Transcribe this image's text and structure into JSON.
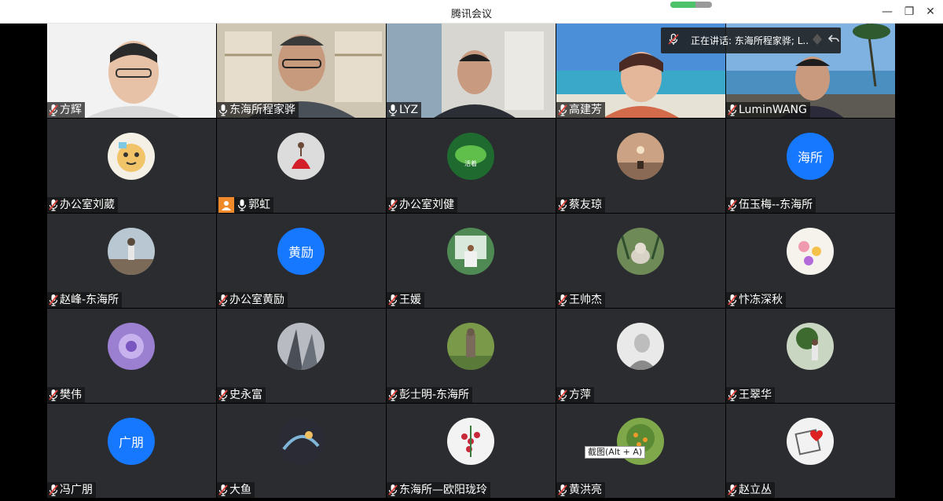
{
  "window": {
    "title": "腾讯会议",
    "signal_level": 0.6,
    "controls": [
      "—",
      "❐",
      "✕"
    ]
  },
  "speaking_banner": {
    "text": "正在讲话: 东海所程家骅; L..."
  },
  "tooltip": "截图(Alt + A)",
  "participants": [
    {
      "name": "方辉",
      "mic": "muted",
      "kind": "video",
      "scene": "office-white"
    },
    {
      "name": "东海所程家骅",
      "mic": "on",
      "kind": "video",
      "scene": "bookshelf",
      "active": true
    },
    {
      "name": "LYZ",
      "mic": "on",
      "kind": "video",
      "scene": "window-room"
    },
    {
      "name": "高建芳",
      "mic": "muted",
      "kind": "video",
      "scene": "ocean"
    },
    {
      "name": "LuminWANG",
      "mic": "muted",
      "kind": "video",
      "scene": "beach"
    },
    {
      "name": "办公室刘葳",
      "mic": "muted",
      "kind": "avatar",
      "avatar": "cartoon-tiger"
    },
    {
      "name": "郭虹",
      "mic": "on",
      "kind": "avatar",
      "avatar": "red-dancer",
      "camera_icon": true
    },
    {
      "name": "办公室刘健",
      "mic": "muted",
      "kind": "avatar",
      "avatar": "green-leaf"
    },
    {
      "name": "蔡友琼",
      "mic": "muted",
      "kind": "avatar",
      "avatar": "sunset-dusk"
    },
    {
      "name": "伍玉梅--东海所",
      "mic": "muted",
      "kind": "text",
      "avatar_text": "海所"
    },
    {
      "name": "赵峰-东海所",
      "mic": "muted",
      "kind": "avatar",
      "avatar": "person-sky"
    },
    {
      "name": "办公室黄励",
      "mic": "muted",
      "kind": "text",
      "avatar_text": "黄励"
    },
    {
      "name": "王媛",
      "mic": "muted",
      "kind": "avatar",
      "avatar": "garden"
    },
    {
      "name": "王帅杰",
      "mic": "muted",
      "kind": "avatar",
      "avatar": "cat-plants"
    },
    {
      "name": "忭冻深秋",
      "mic": "muted",
      "kind": "avatar",
      "avatar": "flowers"
    },
    {
      "name": "樊伟",
      "mic": "muted",
      "kind": "avatar",
      "avatar": "purple-bloom"
    },
    {
      "name": "史永富",
      "mic": "muted",
      "kind": "avatar",
      "avatar": "buildings"
    },
    {
      "name": "彭士明-东海所",
      "mic": "muted",
      "kind": "avatar",
      "avatar": "statue"
    },
    {
      "name": "方萍",
      "mic": "muted",
      "kind": "avatar",
      "avatar": "bw-portrait"
    },
    {
      "name": "王翠华",
      "mic": "muted",
      "kind": "avatar",
      "avatar": "tree-person"
    },
    {
      "name": "冯广朋",
      "mic": "muted",
      "kind": "text",
      "avatar_text": "广朋"
    },
    {
      "name": "大鱼",
      "mic": "muted",
      "kind": "avatar",
      "avatar": "dark-art"
    },
    {
      "name": "东海所—欧阳珑玲",
      "mic": "muted",
      "kind": "avatar",
      "avatar": "red-berries"
    },
    {
      "name": "黄洪亮",
      "mic": "muted",
      "kind": "avatar",
      "avatar": "orange-tree"
    },
    {
      "name": "赵立丛",
      "mic": "muted",
      "kind": "avatar",
      "avatar": "red-heart"
    }
  ],
  "colors": {
    "tile_bg": "#2a2c2f",
    "accent": "#1677ff",
    "active_border": "#2fa84f",
    "muted_red": "#e0443b"
  }
}
